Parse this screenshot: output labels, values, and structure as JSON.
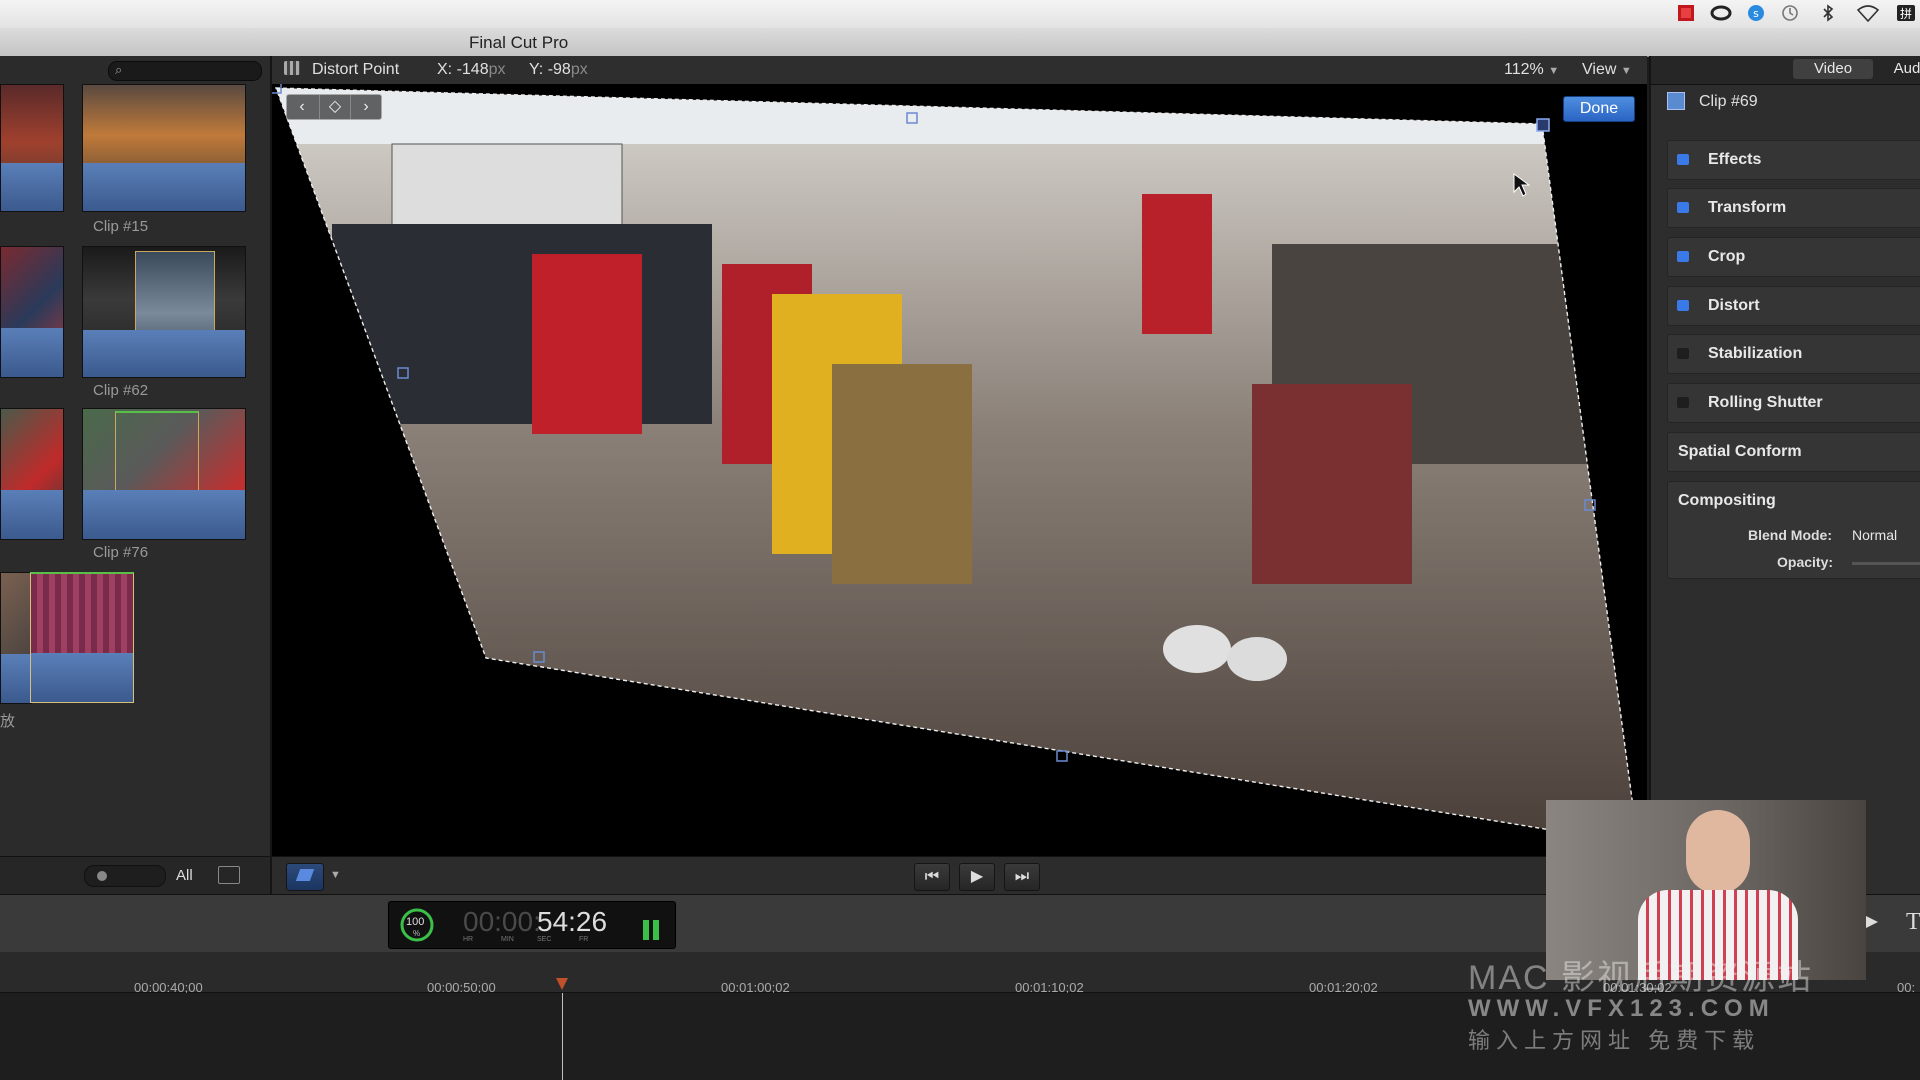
{
  "app": {
    "title": "Final Cut Pro"
  },
  "menubar": {
    "icons": [
      "red-square-icon",
      "creative-cloud-icon",
      "bluetooth-icon",
      "time-machine-icon",
      "bluetooth-symbol-icon",
      "wifi-icon",
      "input-method-icon"
    ]
  },
  "browser": {
    "clips": [
      {
        "label": "Clip #15"
      },
      {
        "label": "Clip #62"
      },
      {
        "label": "Clip #76"
      }
    ],
    "partial_label": "放",
    "filter_label": "All"
  },
  "viewer": {
    "mode_label": "Distort Point",
    "x_label": "X:",
    "x_value": "-148",
    "y_label": "Y:",
    "y_value": "-98",
    "unit": "px",
    "zoom": "112%",
    "view_label": "View",
    "done_label": "Done"
  },
  "inspector": {
    "tab_video": "Video",
    "tab_audio": "Aud",
    "clip_name": "Clip #69",
    "sections": [
      {
        "label": "Effects",
        "enabled": true
      },
      {
        "label": "Transform",
        "enabled": true
      },
      {
        "label": "Crop",
        "enabled": true
      },
      {
        "label": "Distort",
        "enabled": true
      },
      {
        "label": "Stabilization",
        "enabled": false
      },
      {
        "label": "Rolling Shutter",
        "enabled": false
      }
    ],
    "spatial_conform": "Spatial Conform",
    "compositing": "Compositing",
    "blend_mode_label": "Blend Mode:",
    "blend_mode_value": "Normal",
    "opacity_label": "Opacity:"
  },
  "dashboard": {
    "progress": "100",
    "progress_unit": "%",
    "timecode_dim": "00:00:",
    "timecode_main": "54:26",
    "units": [
      "HR",
      "MIN",
      "SEC",
      "FR"
    ]
  },
  "timeline": {
    "ticks": [
      "00:00:40;00",
      "00:00:50;00",
      "00:01:00;02",
      "00:01:10;02",
      "00:01:20;02",
      "00:01:30;02",
      "00:"
    ]
  },
  "watermark": {
    "line1": "MAC 影视后期资源站",
    "line2": "WWW.VFX123.COM",
    "line3": "输入上方网址 免费下载"
  }
}
